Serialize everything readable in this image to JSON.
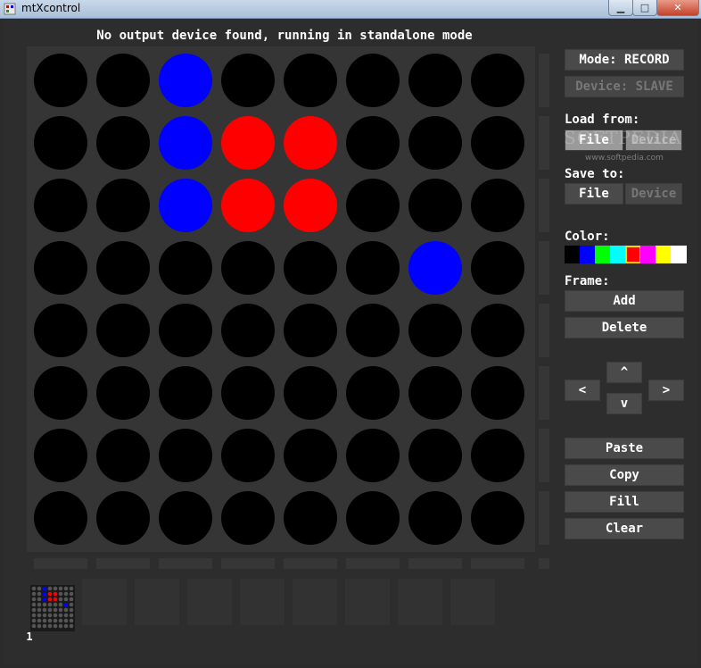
{
  "window": {
    "title": "mtXcontrol"
  },
  "status_message": "No output device found, running in standalone mode",
  "matrix": {
    "rows": [
      [
        "black",
        "black",
        "blue",
        "black",
        "black",
        "black",
        "black",
        "black"
      ],
      [
        "black",
        "black",
        "blue",
        "red",
        "red",
        "black",
        "black",
        "black"
      ],
      [
        "black",
        "black",
        "blue",
        "red",
        "red",
        "black",
        "black",
        "black"
      ],
      [
        "black",
        "black",
        "black",
        "black",
        "black",
        "black",
        "blue",
        "black"
      ],
      [
        "black",
        "black",
        "black",
        "black",
        "black",
        "black",
        "black",
        "black"
      ],
      [
        "black",
        "black",
        "black",
        "black",
        "black",
        "black",
        "black",
        "black"
      ],
      [
        "black",
        "black",
        "black",
        "black",
        "black",
        "black",
        "black",
        "black"
      ],
      [
        "black",
        "black",
        "black",
        "black",
        "black",
        "black",
        "black",
        "black"
      ]
    ]
  },
  "colors": {
    "black": "#000000",
    "blue": "#0000ff",
    "red": "#ff0000"
  },
  "sidebar": {
    "mode_button": "Mode: RECORD",
    "device_button": "Device: SLAVE",
    "load_label": "Load from:",
    "load_file": "File",
    "load_device": "Device",
    "save_label": "Save to:",
    "save_file": "File",
    "save_device": "Device",
    "color_label": "Color:",
    "palette": [
      "#000000",
      "#0000ff",
      "#00ff00",
      "#00ffff",
      "#ff0000",
      "#ff00ff",
      "#ffff00",
      "#ffffff"
    ],
    "selected_color_index": 4,
    "frame_label": "Frame:",
    "add_button": "Add",
    "delete_button": "Delete",
    "nav": {
      "up": "^",
      "left": "<",
      "right": ">",
      "down": "v"
    },
    "paste_button": "Paste",
    "copy_button": "Copy",
    "fill_button": "Fill",
    "clear_button": "Clear"
  },
  "frames": [
    {
      "label": "1"
    }
  ],
  "watermark": {
    "brand": "SOFTPEDIA",
    "url": "www.softpedia.com"
  }
}
